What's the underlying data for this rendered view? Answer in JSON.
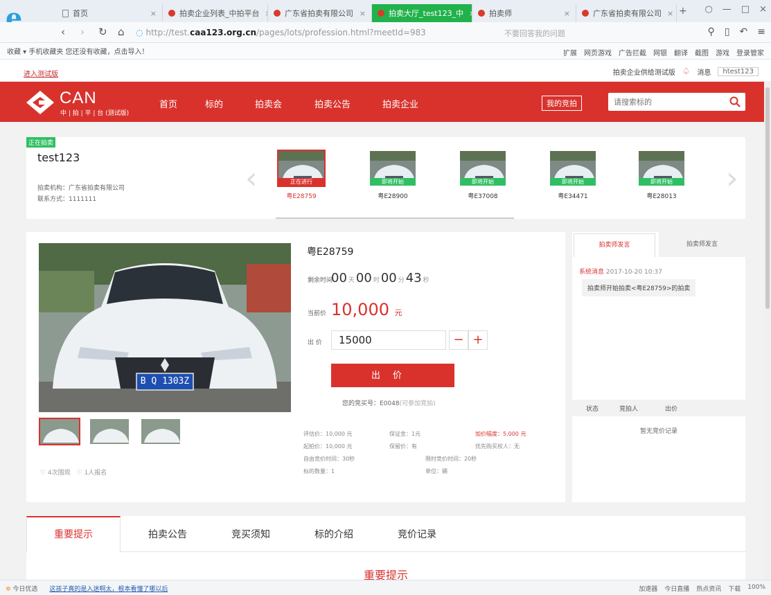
{
  "browser": {
    "tabs": [
      {
        "title": "首页",
        "active": false
      },
      {
        "title": "拍卖企业列表_中拍平台",
        "active": false
      },
      {
        "title": "广东省拍卖有限公司",
        "active": false
      },
      {
        "title": "拍卖大厅_test123_中",
        "active": true
      },
      {
        "title": "拍卖师",
        "active": false
      },
      {
        "title": "广东省拍卖有限公司",
        "active": false
      }
    ],
    "url_prefix": "http://test.",
    "url_host": "caa123.org.cn",
    "url_path": "/pages/lots/profession.html?meetId=983",
    "search_hint": "不要回答我的问题",
    "bookmarks_left": "收藏 ▾   手机收藏夹   您还没有收藏，点击导入！",
    "bookmarks_right": [
      "扩展",
      "网页游戏",
      "广告拦截",
      "网银",
      "翻译",
      "截图",
      "游戏",
      "登录管家"
    ]
  },
  "site": {
    "login_link": "进入测试版",
    "strip_links": [
      "拍卖企业供给测试版",
      "消息",
      "htest123"
    ],
    "logo_text": "CAN",
    "logo_sub": "中 | 拍 | 平 | 台 (测试版)",
    "nav": [
      "首页",
      "标的",
      "拍卖会",
      "拍卖公告",
      "拍卖企业"
    ],
    "my_bid": "我的竞拍",
    "search_placeholder": "请搜索标的"
  },
  "lot": {
    "status_tag": "正在拍卖",
    "name": "test123",
    "org": "拍卖机构：广东省拍卖有限公司",
    "contact": "联系方式：1111111",
    "carousel": [
      {
        "plate": "粤E28759",
        "label": "正在进行",
        "current": true
      },
      {
        "plate": "粤E28900",
        "label": "即将开始",
        "current": false
      },
      {
        "plate": "粤E37008",
        "label": "即将开始",
        "current": false
      },
      {
        "plate": "粤E34471",
        "label": "即将开始",
        "current": false
      },
      {
        "plate": "粤E28013",
        "label": "即将开始",
        "current": false
      }
    ]
  },
  "detail": {
    "plate_title": "粤E28759",
    "countdown_label": "剩余时间",
    "countdown": {
      "days": "00",
      "hours": "00",
      "minutes": "00",
      "seconds": "43"
    },
    "units": {
      "day": "天",
      "hour": "时",
      "minute": "分",
      "second": "秒",
      "yuan": "元"
    },
    "current_price_label": "当前价",
    "current_price": "10,000",
    "bid_label": "出 价",
    "bid_value": "15000",
    "minus": "−",
    "plus": "+",
    "bid_button": "出价",
    "bidder_no": "您的竞买号：E0048",
    "bidder_hint": "(可参加竞拍)",
    "favs": "♡ 4次围观　♡ 1人报名",
    "plate_on_car": "B Q 1303Z",
    "info": {
      "start_price": "评估价：10,000 元",
      "deposit": "保证金：1元",
      "increment": "加价幅度：5,000 元",
      "reserve": "起拍价：10,000 元",
      "has_reserve": "保留价：有",
      "priority": "优先购买权人：无",
      "auto_extend": "自由竞价时间：30秒",
      "limit_extend": "限时竞价时间：20秒",
      "count": "标的数量：1",
      "unit": "单位：辆"
    }
  },
  "side": {
    "tab_active": "拍卖师发言",
    "tab_inactive": "拍卖师发言",
    "sys_label": "系统消息",
    "sys_time": "2017-10-20 10:37",
    "message": "拍卖师开始拍卖<粤E28759>的拍卖",
    "rec_cols": [
      "状态",
      "竞拍人",
      "出价"
    ],
    "no_record": "暂无竞价记录"
  },
  "bottom": {
    "tabs": [
      "重要提示",
      "拍卖公告",
      "竞买须知",
      "标的介绍",
      "竞价记录"
    ],
    "section_title": "重要提示"
  },
  "status": {
    "left": "今日优选",
    "link": "这孩子真的是入迷啊太，根本看懂了哪以后",
    "right": [
      "加速器",
      "今日直播",
      "热点资讯",
      "下载",
      "100%"
    ]
  }
}
